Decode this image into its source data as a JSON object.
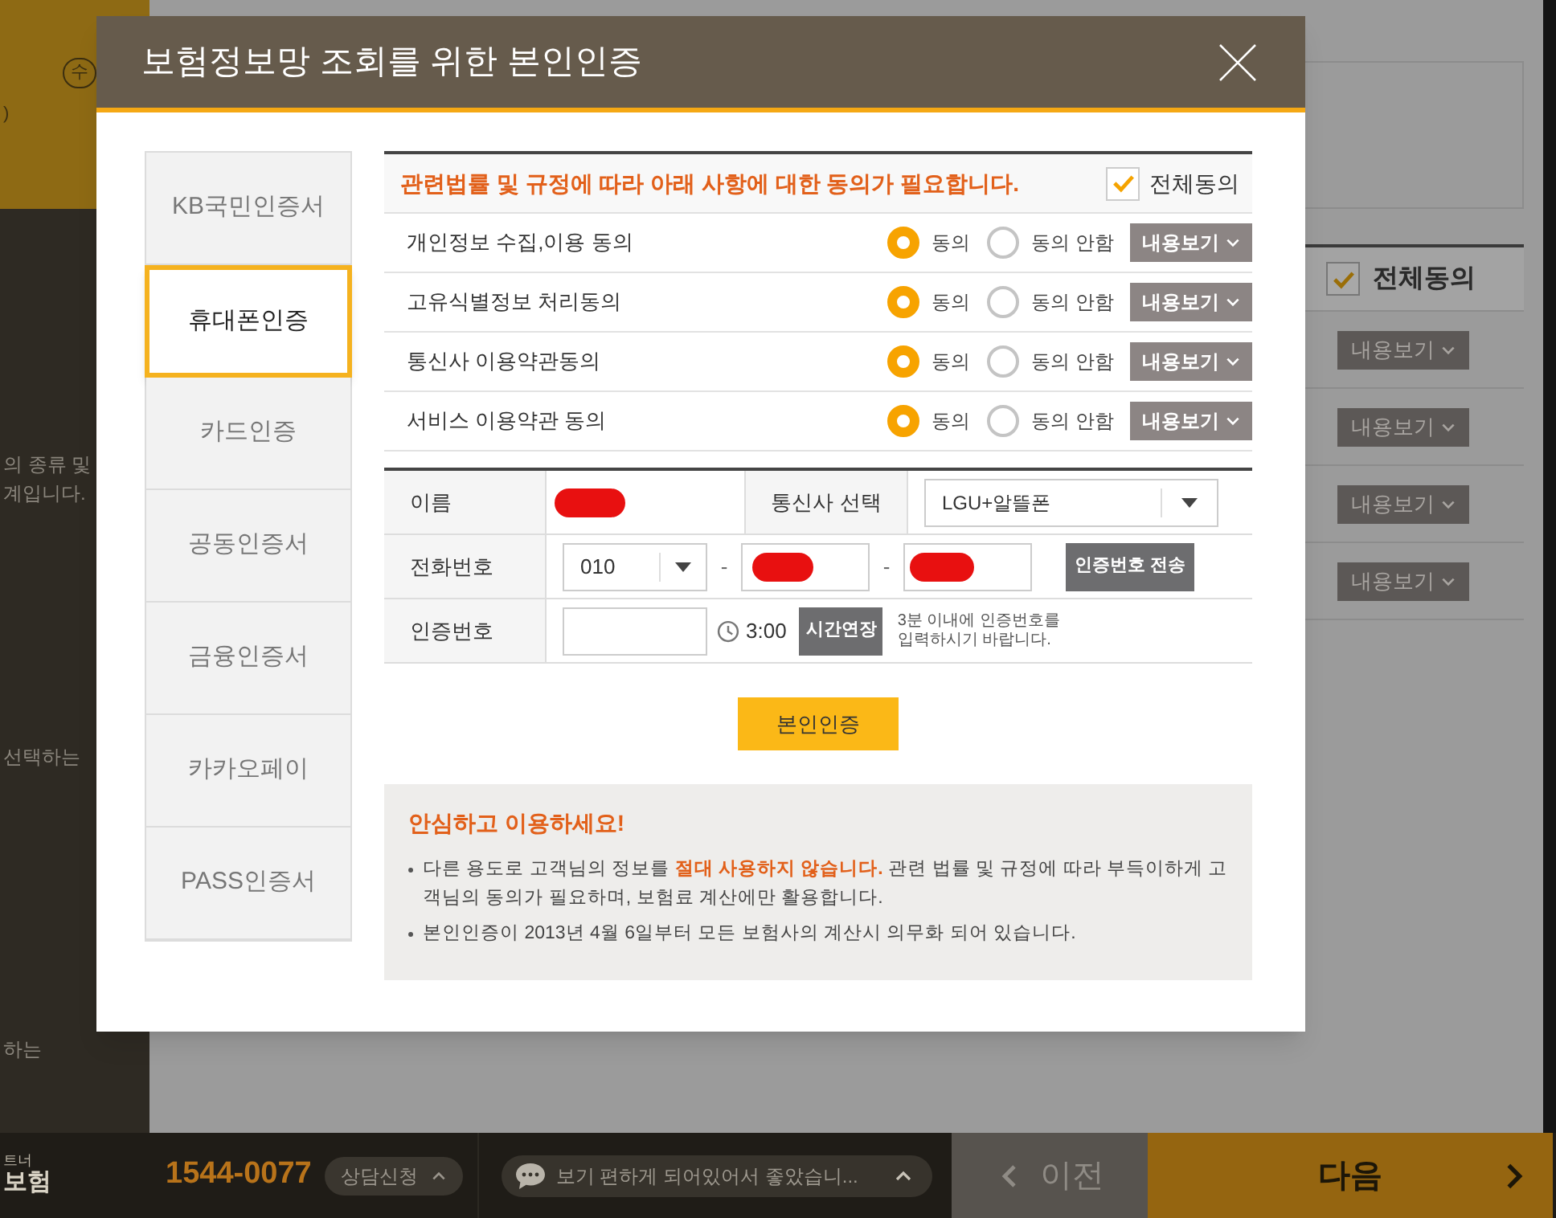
{
  "background": {
    "left_panel": {
      "badge": "수",
      "texts": [
        ")",
        "의 종류 및",
        "계입니다.",
        "선택하는",
        "하는"
      ]
    },
    "consent": {
      "all_agree": {
        "label": "전체동의",
        "checked": true
      },
      "buttons": [
        "내용보기",
        "내용보기",
        "내용보기",
        "내용보기"
      ]
    }
  },
  "dialog": {
    "title": "보험정보망 조회를 위한 본인인증",
    "tabs": [
      {
        "label": "KB국민인증서",
        "selected": false
      },
      {
        "label": "휴대폰인증",
        "selected": true
      },
      {
        "label": "카드인증",
        "selected": false
      },
      {
        "label": "공동인증서",
        "selected": false
      },
      {
        "label": "금융인증서",
        "selected": false
      },
      {
        "label": "카카오페이",
        "selected": false
      },
      {
        "label": "PASS인증서",
        "selected": false
      }
    ],
    "consent": {
      "header": "관련법률 및 규정에 따라 아래 사항에 대한 동의가 필요합니다.",
      "all_agree": {
        "label": "전체동의",
        "checked": true
      },
      "items": [
        {
          "label": "개인정보 수집,이용 동의",
          "options": [
            {
              "label": "동의",
              "selected": true
            },
            {
              "label": "동의 안함",
              "selected": false
            }
          ],
          "view_button": "내용보기"
        },
        {
          "label": "고유식별정보 처리동의",
          "options": [
            {
              "label": "동의",
              "selected": true
            },
            {
              "label": "동의 안함",
              "selected": false
            }
          ],
          "view_button": "내용보기"
        },
        {
          "label": "통신사 이용약관동의",
          "options": [
            {
              "label": "동의",
              "selected": true
            },
            {
              "label": "동의 안함",
              "selected": false
            }
          ],
          "view_button": "내용보기"
        },
        {
          "label": "서비스 이용약관 동의",
          "options": [
            {
              "label": "동의",
              "selected": true
            },
            {
              "label": "동의 안함",
              "selected": false
            }
          ],
          "view_button": "내용보기"
        }
      ]
    },
    "form": {
      "name": {
        "label": "이름",
        "redacted": true
      },
      "carrier": {
        "label": "통신사 선택",
        "value": "LGU+알뜰폰"
      },
      "phone": {
        "label": "전화번호",
        "prefix": "010",
        "separators": [
          "-",
          "-"
        ],
        "middle": {
          "redacted": true
        },
        "last": {
          "redacted": true
        },
        "send_button": "인증번호 전송"
      },
      "code": {
        "label": "인증번호",
        "timer": "3:00",
        "extend_button": "시간연장",
        "note": "3분 이내에 인증번호를\n입력하시기 바랍니다."
      }
    },
    "submit": "본인인증",
    "notice": {
      "title": "안심하고 이용하세요!",
      "bullets": [
        "다른 용도로 고객님의 정보를 **절대 사용하지 않습니다.** 관련 법률 및 규정에 따라 부득이하게 고객님의 동의가 필요하며, 보험료 계산에만 활용합니다.",
        "본인인증이 2013년 4월 6일부터 모든 보험사의 계산시 의무화 되어 있습니다."
      ]
    }
  },
  "footer": {
    "logo": [
      "트너",
      "보험"
    ],
    "phone": "1544-0077",
    "consult_button": "상담신청",
    "review": "보기 편하게 되어있어서 좋았습니...",
    "prev": "이전",
    "next": "다음"
  }
}
